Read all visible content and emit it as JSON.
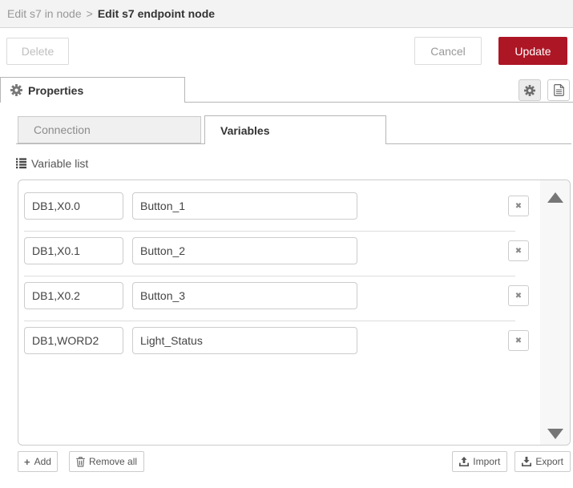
{
  "header": {
    "breadcrumb": {
      "parent": "Edit s7 in node",
      "separator": ">",
      "current": "Edit s7 endpoint node"
    }
  },
  "dialog_buttons": {
    "delete": "Delete",
    "cancel": "Cancel",
    "update": "Update"
  },
  "editor": {
    "properties_tab": "Properties"
  },
  "node_tabs": {
    "connection": "Connection",
    "variables": "Variables"
  },
  "variables_panel": {
    "list_label": "Variable list",
    "rows": [
      {
        "address": "DB1,X0.0",
        "name": "Button_1"
      },
      {
        "address": "DB1,X0.1",
        "name": "Button_2"
      },
      {
        "address": "DB1,X0.2",
        "name": "Button_3"
      },
      {
        "address": "DB1,WORD2",
        "name": "Light_Status"
      }
    ],
    "footer": {
      "add": "Add",
      "remove_all": "Remove all",
      "import": "Import",
      "export": "Export"
    }
  },
  "glyphs": {
    "plus": "+",
    "remove_x": "✖"
  },
  "icons": [
    "gear-icon",
    "file-text-icon",
    "list-icon",
    "plus-icon",
    "trash-icon",
    "upload-icon",
    "download-icon",
    "x-icon",
    "triangle-up-icon",
    "triangle-down-icon"
  ],
  "colors": {
    "accent_red": "#ad1625",
    "header_bg": "#f3f3f3",
    "tab_inactive_bg": "#f0f0f0",
    "border_gray": "#cccccc",
    "text_primary": "#333333",
    "text_muted": "#999999"
  }
}
